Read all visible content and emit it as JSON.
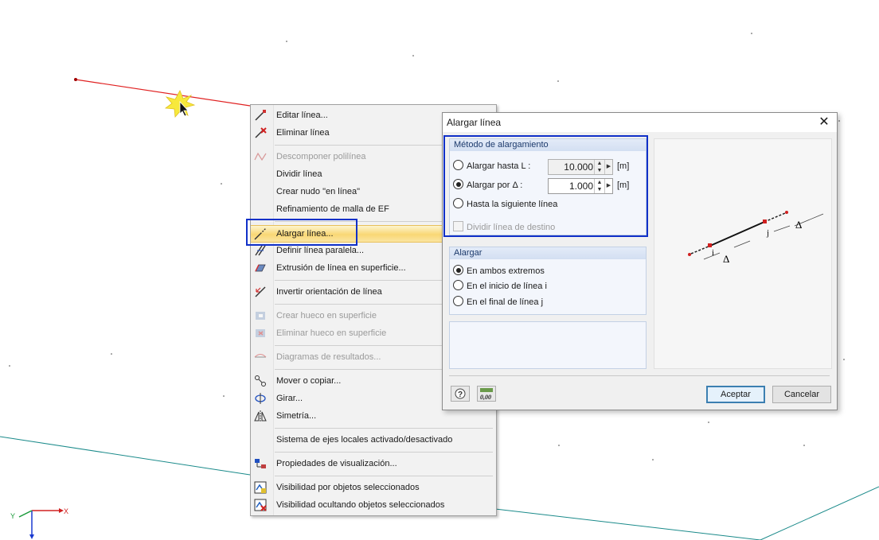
{
  "menu": {
    "items": [
      {
        "label": "Editar línea...",
        "icon": "edit-line-icon",
        "disabled": false
      },
      {
        "label": "Eliminar línea",
        "icon": "delete-line-icon",
        "disabled": false
      },
      {
        "label": "Descomponer polilínea",
        "icon": "explode-polyline-icon",
        "disabled": true
      },
      {
        "label": "Dividir línea",
        "icon": "",
        "disabled": false
      },
      {
        "label": "Crear nudo \"en línea\"",
        "icon": "",
        "disabled": false
      },
      {
        "label": "Refinamiento de malla de EF",
        "icon": "",
        "disabled": false
      },
      {
        "label": "Alargar línea...",
        "icon": "extend-line-icon",
        "disabled": false,
        "highlighted": true
      },
      {
        "label": "Definir línea paralela...",
        "icon": "parallel-line-icon",
        "disabled": false
      },
      {
        "label": "Extrusión de línea en superficie...",
        "icon": "extrude-icon",
        "disabled": false
      },
      {
        "label": "Invertir orientación de línea",
        "icon": "reverse-orientation-icon",
        "disabled": false
      },
      {
        "label": "Crear hueco en superficie",
        "icon": "create-opening-icon",
        "disabled": true
      },
      {
        "label": "Eliminar hueco en superficie",
        "icon": "delete-opening-icon",
        "disabled": true
      },
      {
        "label": "Diagramas de resultados...",
        "icon": "result-diagram-icon",
        "disabled": true
      },
      {
        "label": "Mover o copiar...",
        "icon": "move-copy-icon",
        "disabled": false
      },
      {
        "label": "Girar...",
        "icon": "rotate-icon",
        "disabled": false
      },
      {
        "label": "Simetría...",
        "icon": "mirror-icon",
        "disabled": false
      },
      {
        "label": "Sistema de ejes locales activado/desactivado",
        "icon": "",
        "disabled": false
      },
      {
        "label": "Propiedades de visualización...",
        "icon": "display-properties-icon",
        "disabled": false
      },
      {
        "label": "Visibilidad por objetos seleccionados",
        "icon": "visibility-selected-icon",
        "disabled": false
      },
      {
        "label": "Visibilidad ocultando objetos seleccionados",
        "icon": "visibility-hide-icon",
        "disabled": false
      }
    ]
  },
  "dialog": {
    "title": "Alargar línea",
    "close_glyph": "✕",
    "method": {
      "header": "Método de alargamiento",
      "opt_length": "Alargar hasta L :",
      "opt_length_value": "10.000",
      "opt_length_unit": "[m]",
      "opt_delta": "Alargar por Δ :",
      "opt_delta_value": "1.000",
      "opt_delta_unit": "[m]",
      "opt_next": "Hasta la siguiente línea",
      "split_target": "Dividir línea de destino",
      "selected": "delta"
    },
    "extend": {
      "header": "Alargar",
      "opt_both": "En ambos extremos",
      "opt_start": "En el inicio de línea i",
      "opt_end": "En el final de línea j",
      "selected": "both"
    },
    "preview": {
      "label_i": "i",
      "label_j": "j",
      "delta": "Δ"
    },
    "ok_label": "Aceptar",
    "cancel_label": "Cancelar",
    "help_icon": "help-icon",
    "calc_icon": "calculator-icon",
    "calc_text": "0,00"
  },
  "axes": {
    "x": "X",
    "y": "Y"
  },
  "colors": {
    "highlight": "#f9d774",
    "annotation_box": "#1030c8",
    "selected_line": "#e02020",
    "grid_line": "#1a8a8a"
  }
}
